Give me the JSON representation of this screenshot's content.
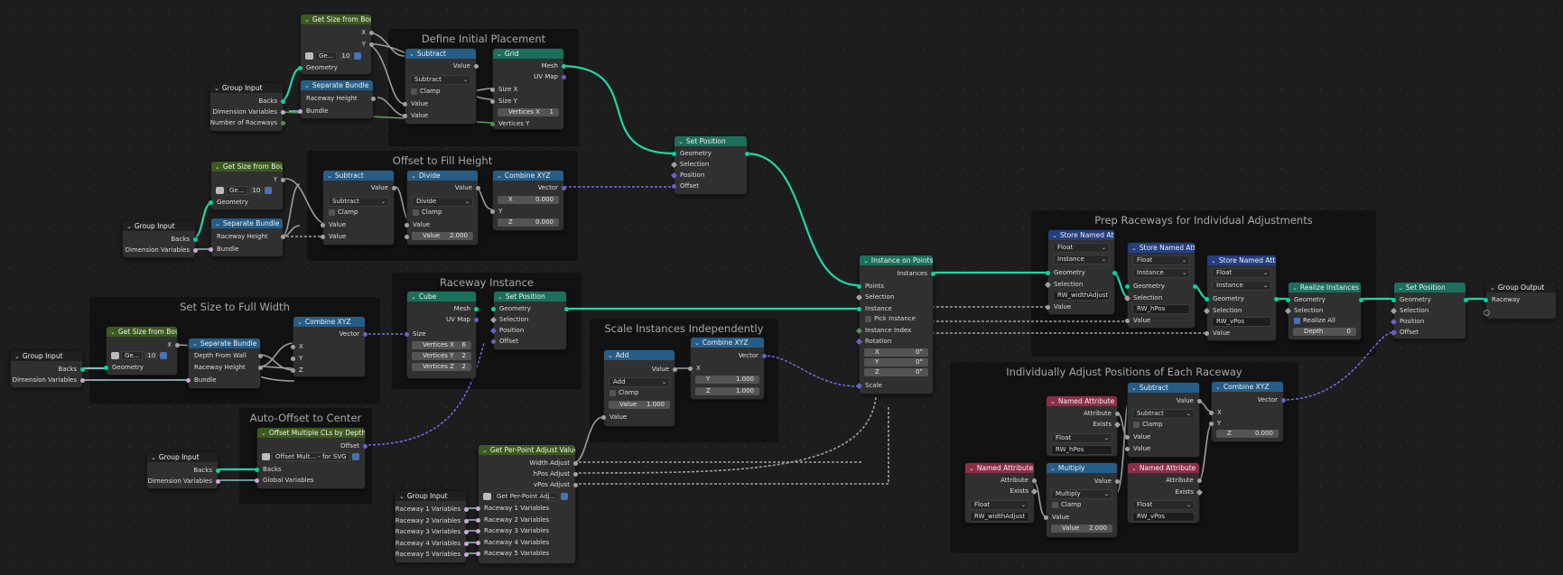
{
  "colors": {
    "geometry": "#00d6a3",
    "float": "#a1a1a1",
    "vector": "#6363c7",
    "bundle": "#cca6d6",
    "integer": "#598c5c",
    "string": "#70b2ff"
  },
  "frames": {
    "define_initial_placement": "Define Initial Placement",
    "offset_to_fill_height": "Offset to Fill Height",
    "set_size_full_width": "Set Size to Full Width",
    "raceway_instance": "Raceway Instance",
    "scale_instances": "Scale Instances Independently",
    "auto_offset_center": "Auto-Offset to Center",
    "prep_raceways": "Prep Raceways for Individual Adjustments",
    "adjust_positions": "Individually Adjust Positions of Each Raceway"
  },
  "n1": {
    "title": "Group Input",
    "backs": "Backs",
    "dimvars": "Dimension Variables",
    "numraceways": "Number of Raceways"
  },
  "n2": {
    "title": "Get Size from Bou...",
    "x": "X",
    "y": "Y",
    "grpname": "Ge...",
    "count": "10",
    "geometry": "Geometry"
  },
  "n3": {
    "title": "Separate Bundle",
    "rh": "Raceway Height",
    "bundle": "Bundle"
  },
  "n4": {
    "title": "Subtract",
    "value": "Value",
    "op": "Subtract",
    "clamp": "Clamp",
    "v1": "Value",
    "v2": "Value"
  },
  "n5": {
    "title": "Grid",
    "mesh": "Mesh",
    "uvmap": "UV Map",
    "sizex": "Size X",
    "sizey": "Size Y",
    "vx": "Vertices X",
    "vxval": "1",
    "vy": "Vertices Y"
  },
  "n6": {
    "title": "Group Input",
    "backs": "Backs",
    "dimvars": "Dimension Variables"
  },
  "n7": {
    "title": "Get Size from Bou...",
    "y": "Y",
    "grpname": "Ge...",
    "count": "10",
    "geometry": "Geometry"
  },
  "n8": {
    "title": "Separate Bundle",
    "rh": "Raceway Height",
    "bundle": "Bundle"
  },
  "n9": {
    "title": "Subtract",
    "value": "Value",
    "op": "Subtract",
    "clamp": "Clamp",
    "v1": "Value",
    "v2": "Value"
  },
  "n10": {
    "title": "Divide",
    "value": "Value",
    "op": "Divide",
    "clamp": "Clamp",
    "v1": "Value",
    "v2": "Value",
    "v2val": "2.000"
  },
  "n11": {
    "title": "Combine XYZ",
    "vector": "Vector",
    "x": "X",
    "xval": "0.000",
    "y": "Y",
    "z": "Z",
    "zval": "0.000"
  },
  "n12": {
    "title": "Set Position",
    "geometry": "Geometry",
    "selection": "Selection",
    "position": "Position",
    "offset": "Offset"
  },
  "n13": {
    "title": "Group Input",
    "backs": "Backs",
    "dimvars": "Dimension Variables"
  },
  "n14": {
    "title": "Get Size from Bou...",
    "x": "X",
    "grpname": "Ge...",
    "count": "10",
    "geometry": "Geometry"
  },
  "n15": {
    "title": "Separate Bundle",
    "dfw": "Depth From Wall",
    "rh": "Raceway Height",
    "bundle": "Bundle"
  },
  "n16": {
    "title": "Combine XYZ",
    "vector": "Vector",
    "x": "X",
    "y": "Y",
    "z": "Z"
  },
  "n17": {
    "title": "Cube",
    "mesh": "Mesh",
    "uvmap": "UV Map",
    "size": "Size",
    "vx": "Vertices X",
    "vxval": "6",
    "vy": "Vertices Y",
    "vyval": "2",
    "vz": "Vertices Z",
    "vzval": "2"
  },
  "n18": {
    "title": "Set Position",
    "geometry": "Geometry",
    "selection": "Selection",
    "position": "Position",
    "offset": "Offset"
  },
  "n19": {
    "title": "Add",
    "value": "Value",
    "op": "Add",
    "clamp": "Clamp",
    "v1": "Value",
    "v1val": "1.000",
    "v2": "Value"
  },
  "n20": {
    "title": "Combine XYZ",
    "vector": "Vector",
    "x": "X",
    "y": "Y",
    "yval": "1.000",
    "z": "Z",
    "zval": "1.000"
  },
  "n21": {
    "title": "Offset Multiple CLs by Depth - ...",
    "offset": "Offset",
    "grpname": "Offset Mult... - for SVG",
    "backs": "Backs",
    "globals": "Global Variables"
  },
  "n22": {
    "title": "Group Input",
    "backs": "Backs",
    "dimvars": "Dimension Variables"
  },
  "n23": {
    "title": "Get Per-Point Adjust Values",
    "wa": "Width Adjust",
    "ha": "hPos Adjust",
    "va": "vPos Adjust",
    "grpname": "Get Per-Point Adj...",
    "r1": "Raceway 1 Variables",
    "r2": "Raceway 2 Variables",
    "r3": "Raceway 3 Variables",
    "r4": "Raceway 4 Variables",
    "r5": "Raceway 5 Variables"
  },
  "n24": {
    "title": "Group Input",
    "r1": "Raceway 1 Variables",
    "r2": "Raceway 2 Variables",
    "r3": "Raceway 3 Variables",
    "r4": "Raceway 4 Variables",
    "r5": "Raceway 5 Variables"
  },
  "n25": {
    "title": "Instance on Points",
    "instances": "Instances",
    "points": "Points",
    "selection": "Selection",
    "instance": "Instance",
    "pick": "Pick Instance",
    "index": "Instance Index",
    "rotation": "Rotation",
    "rx": "X",
    "rxv": "0°",
    "ry": "Y",
    "ryv": "0°",
    "rz": "Z",
    "rzv": "0°",
    "scale": "Scale"
  },
  "n26": {
    "title": "Store Named Attrib...",
    "type": "Float",
    "domain": "Instance",
    "geometry": "Geometry",
    "selection": "Selection",
    "name": "RW_widthAdjust",
    "value": "Value"
  },
  "n27": {
    "title": "Store Named Attrib...",
    "type": "Float",
    "domain": "Instance",
    "geometry": "Geometry",
    "selection": "Selection",
    "name": "RW_hPos",
    "value": "Value"
  },
  "n28": {
    "title": "Store Named Attrib...",
    "type": "Float",
    "domain": "Instance",
    "geometry": "Geometry",
    "selection": "Selection",
    "name": "RW_vPos",
    "value": "Value"
  },
  "n29": {
    "title": "Realize Instances",
    "geometry": "Geometry",
    "selection": "Selection",
    "realize": "Realize All",
    "depth": "Depth",
    "depthval": "0"
  },
  "n30": {
    "title": "Set Position",
    "geometry": "Geometry",
    "selection": "Selection",
    "position": "Position",
    "offset": "Offset"
  },
  "n31": {
    "title": "Group Output",
    "raceway": "Raceway"
  },
  "n32": {
    "title": "Named Attribute",
    "attribute": "Attribute",
    "exists": "Exists",
    "type": "Float",
    "name": "RW_hPos"
  },
  "n33": {
    "title": "Named Attribute",
    "attribute": "Attribute",
    "exists": "Exists",
    "type": "Float",
    "name": "RW_widthAdjust"
  },
  "n34": {
    "title": "Multiply",
    "value": "Value",
    "op": "Multiply",
    "clamp": "Clamp",
    "v1": "Value",
    "v2": "Value",
    "v2val": "2.000"
  },
  "n35": {
    "title": "Subtract",
    "value": "Value",
    "op": "Subtract",
    "clamp": "Clamp",
    "v1": "Value",
    "v2": "Value"
  },
  "n36": {
    "title": "Named Attribute",
    "attribute": "Attribute",
    "exists": "Exists",
    "type": "Float",
    "name": "RW_vPos"
  },
  "n37": {
    "title": "Combine XYZ",
    "vector": "Vector",
    "x": "X",
    "y": "Y",
    "z": "Z",
    "zval": "0.000"
  }
}
